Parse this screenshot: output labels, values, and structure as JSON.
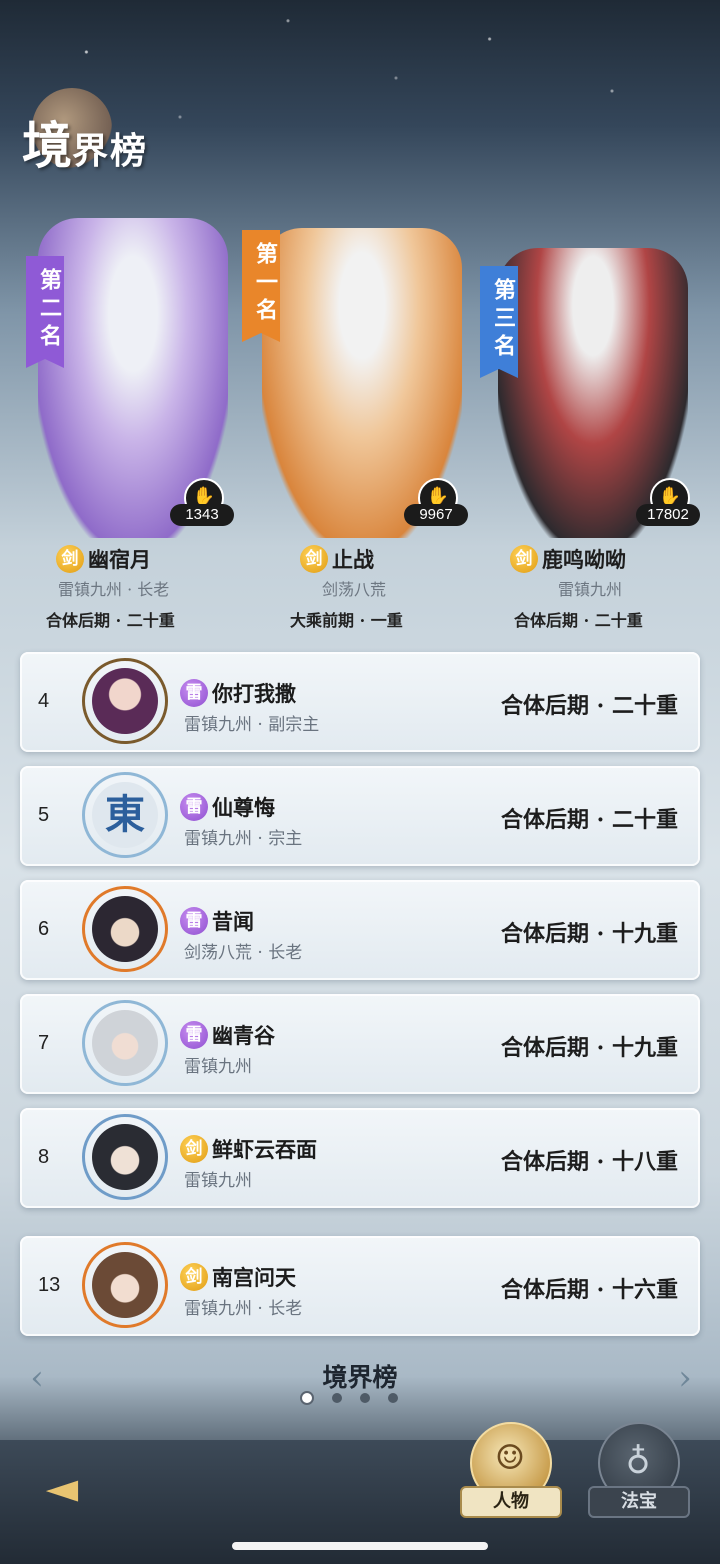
{
  "title": {
    "big": "境",
    "small": "界榜"
  },
  "podium": [
    {
      "rank_label": "第二名",
      "banner_color": "#8f5ad6",
      "likes": "1343",
      "badge": "剑",
      "name": "幽宿月",
      "sub": "雷镇九州 · 长老",
      "realm": "合体后期 · 二十重",
      "figure_colors": [
        "#c9b4e8",
        "#8f6bc9"
      ]
    },
    {
      "rank_label": "第一名",
      "banner_color": "#e9862a",
      "likes": "9967",
      "badge": "剑",
      "name": "止战",
      "sub": "剑荡八荒",
      "realm": "大乘前期 · 一重",
      "figure_colors": [
        "#f0c79a",
        "#d9853c"
      ]
    },
    {
      "rank_label": "第三名",
      "banner_color": "#3f7fd8",
      "likes": "17802",
      "badge": "剑",
      "name": "鹿鸣呦呦",
      "sub": "雷镇九州",
      "realm": "合体后期 · 二十重",
      "figure_colors": [
        "#b04545",
        "#2d2a2e"
      ]
    }
  ],
  "rows": [
    {
      "rank": "4",
      "badge": "雷",
      "badge_type": "thunder",
      "name": "你打我撒",
      "sub": "雷镇九州 · 副宗主",
      "realm": "合体后期 · 二十重",
      "ring": "#7a5a2c",
      "face": "#5a2b57"
    },
    {
      "rank": "5",
      "badge": "雷",
      "badge_type": "thunder",
      "name": "仙尊悔",
      "sub": "雷镇九州 · 宗主",
      "realm": "合体后期 · 二十重",
      "ring": "#8fb7d6",
      "face": "#dfe7ee"
    },
    {
      "rank": "6",
      "badge": "雷",
      "badge_type": "thunder",
      "name": "昔闻",
      "sub": "剑荡八荒 · 长老",
      "realm": "合体后期 · 十九重",
      "ring": "#e07a2a",
      "face": "#2c2732"
    },
    {
      "rank": "7",
      "badge": "雷",
      "badge_type": "thunder",
      "name": "幽青谷",
      "sub": "雷镇九州",
      "realm": "合体后期 · 十九重",
      "ring": "#8fb7d6",
      "face": "#cfd3d8"
    },
    {
      "rank": "8",
      "badge": "剑",
      "badge_type": "sword",
      "name": "鲜虾云吞面",
      "sub": "雷镇九州",
      "realm": "合体后期 · 十八重",
      "ring": "#6f9cc8",
      "face": "#2a2c33"
    },
    {
      "rank": "13",
      "badge": "剑",
      "badge_type": "sword",
      "name": "南宫问天",
      "sub": "雷镇九州 · 长老",
      "realm": "合体后期 · 十六重",
      "ring": "#e07a2a",
      "face": "#6b4a36"
    }
  ],
  "footer": {
    "title": "境界榜",
    "page_count": 4,
    "active_page": 1
  },
  "tabs": [
    {
      "label": "人物",
      "active": true,
      "icon": "person-icon"
    },
    {
      "label": "法宝",
      "active": false,
      "icon": "gourd-icon"
    }
  ]
}
